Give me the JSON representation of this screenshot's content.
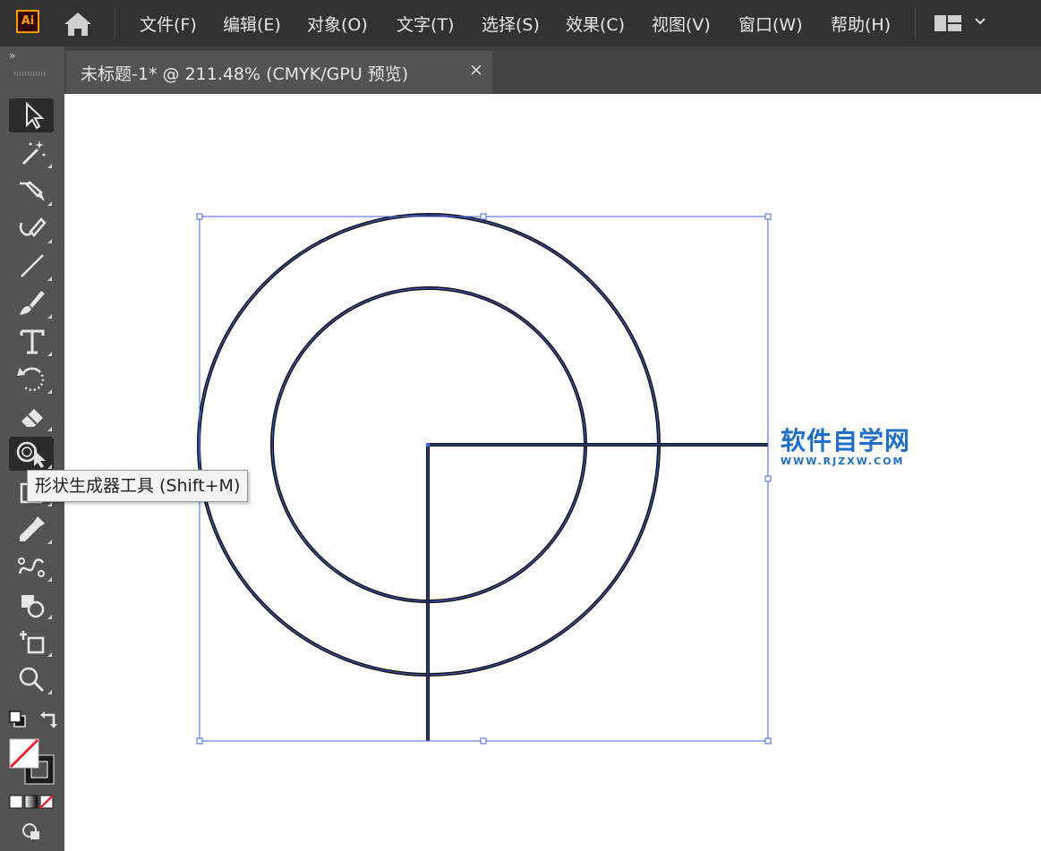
{
  "app": {
    "logo_text": "Ai"
  },
  "menu": {
    "items": [
      "文件(F)",
      "编辑(E)",
      "对象(O)",
      "文字(T)",
      "选择(S)",
      "效果(C)",
      "视图(V)",
      "窗口(W)",
      "帮助(H)"
    ]
  },
  "toolbar": {
    "collapse_label": "»"
  },
  "document": {
    "tab_title": "未标题-1* @ 211.48% (CMYK/GPU 预览)",
    "close_label": "×"
  },
  "tooltip": {
    "text": "形状生成器工具 (Shift+M)"
  },
  "watermark": {
    "title": "软件自学网",
    "url": "WWW.RJZXW.COM"
  },
  "colors": {
    "selection": "#4466dd",
    "logo_orange": "#ff9a00",
    "watermark_blue": "#1f6fc8"
  }
}
